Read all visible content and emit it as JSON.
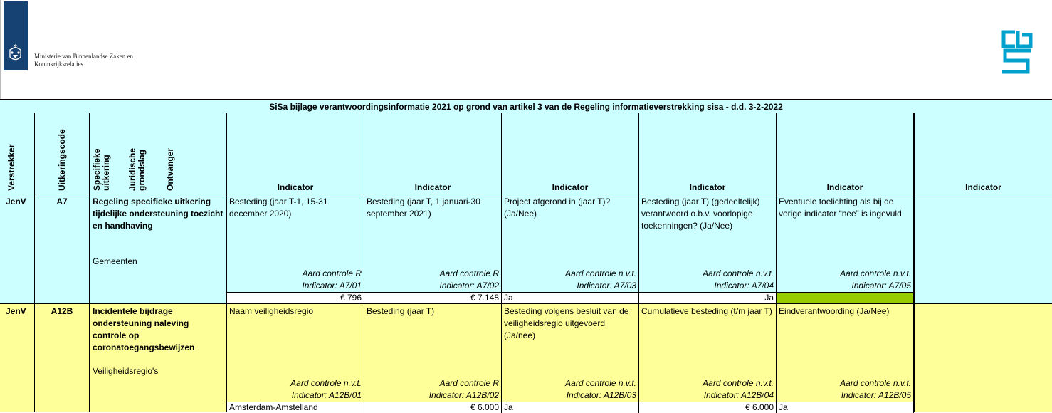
{
  "header": {
    "ministry_lines": [
      "Ministerie van Binnenlandse Zaken en",
      "Koninkrijksrelaties"
    ],
    "ministry_logo": "rijksoverheid-logo",
    "cbs_logo": "cbs-logo"
  },
  "table": {
    "title": "SiSa bijlage verantwoordingsinformatie 2021 op grond van artikel 3 van de Regeling informatieverstrekking sisa - d.d. 3-2-2022",
    "col_headers": {
      "verstrekker": "Verstrekker",
      "uitkeringscode": "Uitkeringscode",
      "specifieke_uitkering": "Specifieke uitkering",
      "juridische_grondslag": "Juridische grondslag",
      "ontvanger": "Ontvanger",
      "indicator": "Indicator"
    },
    "rows": [
      {
        "verstrekker": "JenV",
        "code": "A7",
        "title": "Regeling specifieke uitkering tijdelijke ondersteuning toezicht en handhaving",
        "ontvanger": "Gemeenten",
        "color": "#ccffff",
        "indicators": [
          {
            "desc": "Besteding (jaar T-1, 15-31 december 2020)",
            "control": "Aard controle R",
            "code": "Indicator: A7/01",
            "value": "€ 796"
          },
          {
            "desc": "Besteding (jaar T, 1 januari-30 september 2021)",
            "control": "Aard controle R",
            "code": "Indicator: A7/02",
            "value": "€ 7.148"
          },
          {
            "desc": "Project afgerond in (jaar T)? (Ja/Nee)",
            "control": "Aard controle n.v.t.",
            "code": "Indicator: A7/03",
            "value": "Ja"
          },
          {
            "desc": "Besteding (jaar T) (gedeeltelijk) verantwoord o.b.v. voorlopige toekenningen? (Ja/Nee)",
            "control": "Aard controle n.v.t.",
            "code": "Indicator: A7/04",
            "value": "Ja"
          },
          {
            "desc": "Eventuele toelichting als bij de vorige indicator “nee” is ingevuld",
            "control": "Aard controle n.v.t.",
            "code": "Indicator: A7/05",
            "value": ""
          }
        ]
      },
      {
        "verstrekker": "JenV",
        "code": "A12B",
        "title": "Incidentele bijdrage ondersteuning naleving controle op coronatoegangsbewijzen",
        "ontvanger": "Veiligheidsregio's",
        "color": "#ffff99",
        "indicators": [
          {
            "desc": "Naam veiligheidsregio",
            "control": "Aard controle n.v.t.",
            "code": "Indicator: A12B/01",
            "value": "Amsterdam-Amstelland"
          },
          {
            "desc": "Besteding (jaar T)",
            "control": "Aard controle R",
            "code": "Indicator: A12B/02",
            "value": "€ 6.000"
          },
          {
            "desc": "Besteding volgens besluit van de veiligheidsregio uitgevoerd (Ja/nee)",
            "control": "Aard controle n.v.t.",
            "code": "Indicator: A12B/03",
            "value": "Ja"
          },
          {
            "desc": "Cumulatieve besteding (t/m jaar T)",
            "control": "Aard controle n.v.t.",
            "code": "Indicator: A12B/04",
            "value": "€ 6.000"
          },
          {
            "desc": "Eindverantwoording (Ja/Nee)",
            "control": "Aard controle n.v.t.",
            "code": "Indicator: A12B/05",
            "value": "Ja"
          }
        ]
      }
    ]
  },
  "colors": {
    "cyan": "#ccffff",
    "yellow": "#ffff99",
    "green_cell": "#99cc00",
    "ministry_blue": "#154273",
    "cbs_blue": "#00a1cd"
  }
}
